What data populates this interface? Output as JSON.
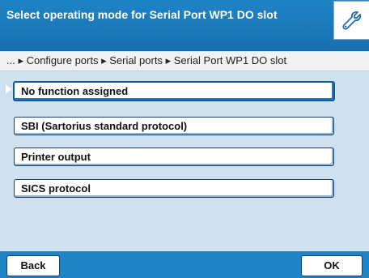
{
  "header": {
    "title": "Select operating mode for Serial Port WP1 DO slot",
    "icon": "wrench-icon"
  },
  "breadcrumb": {
    "text": "... ▸ Configure ports ▸ Serial ports ▸ Serial Port WP1 DO slot"
  },
  "options": [
    {
      "label": "No function assigned",
      "selected": true
    },
    {
      "label": "SBI (Sartorius standard protocol)",
      "selected": false
    },
    {
      "label": "Printer output",
      "selected": false
    },
    {
      "label": "SICS protocol",
      "selected": false
    }
  ],
  "footer": {
    "back_label": "Back",
    "ok_label": "OK"
  },
  "colors": {
    "header_blue": "#1f84c6",
    "content_bg": "#cfe0ef"
  }
}
